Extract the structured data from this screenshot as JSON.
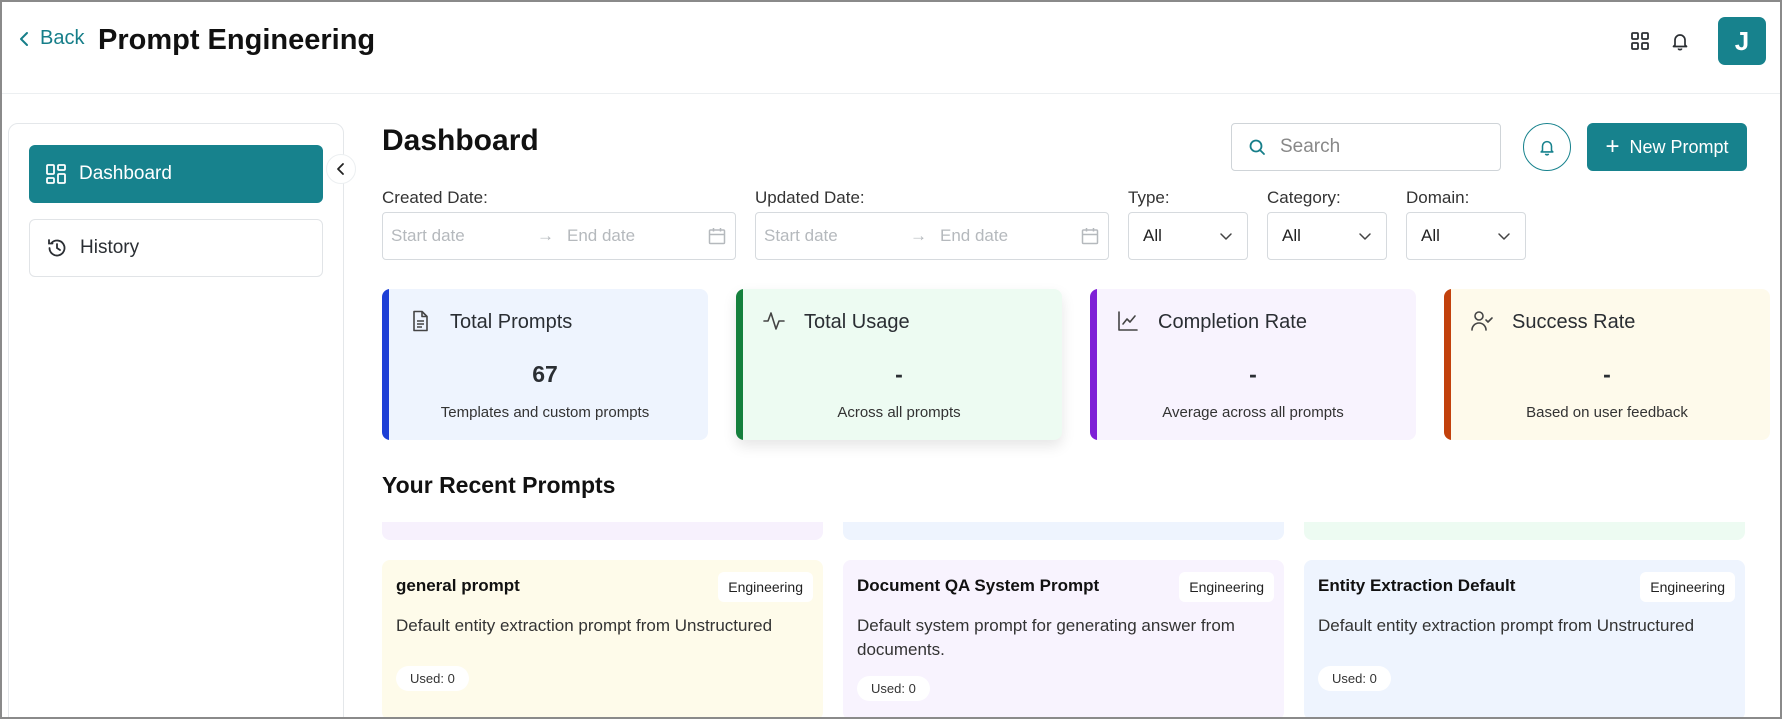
{
  "header": {
    "back_label": "Back",
    "title": "Prompt Engineering",
    "avatar_initial": "J"
  },
  "sidebar": {
    "items": [
      {
        "label": "Dashboard",
        "icon": "dashboard-icon",
        "active": true
      },
      {
        "label": "History",
        "icon": "history-icon",
        "active": false
      }
    ]
  },
  "main": {
    "title": "Dashboard",
    "search": {
      "placeholder": "Search"
    },
    "new_prompt_label": "New Prompt",
    "filters": {
      "created": {
        "label": "Created Date:",
        "start_placeholder": "Start date",
        "end_placeholder": "End date"
      },
      "updated": {
        "label": "Updated Date:",
        "start_placeholder": "Start date",
        "end_placeholder": "End date"
      },
      "type": {
        "label": "Type:",
        "value": "All"
      },
      "category": {
        "label": "Category:",
        "value": "All"
      },
      "domain": {
        "label": "Domain:",
        "value": "All"
      }
    },
    "stats": [
      {
        "title": "Total Prompts",
        "value": "67",
        "subtitle": "Templates and custom prompts",
        "icon": "document-icon",
        "accent": "#1d3fd6",
        "bg": "#eef4fe"
      },
      {
        "title": "Total Usage",
        "value": "-",
        "subtitle": "Across all prompts",
        "icon": "activity-icon",
        "accent": "#15803d",
        "bg": "#edfbf2"
      },
      {
        "title": "Completion Rate",
        "value": "-",
        "subtitle": "Average across all prompts",
        "icon": "chart-icon",
        "accent": "#7e1fd6",
        "bg": "#f8f3fe"
      },
      {
        "title": "Success Rate",
        "value": "-",
        "subtitle": "Based on user feedback",
        "icon": "user-check-icon",
        "accent": "#c2410c",
        "bg": "#fefaeb"
      }
    ],
    "recent_title": "Your Recent Prompts",
    "prompts": [
      {
        "title": "general prompt",
        "tag": "Engineering",
        "description": "Default entity extraction prompt from Unstructured",
        "used": "Used: 0",
        "bg": "#fefbea"
      },
      {
        "title": "Document QA System Prompt",
        "tag": "Engineering",
        "description": "Default system prompt for generating answer from documents.",
        "used": "Used: 0",
        "bg": "#f8f3fe"
      },
      {
        "title": "Entity Extraction Default",
        "tag": "Engineering",
        "description": "Default entity extraction prompt from Unstructured",
        "used": "Used: 0",
        "bg": "#eef4fe"
      }
    ]
  },
  "colors": {
    "brand": "#17828d",
    "strip_purple": "#f7f1fd",
    "strip_blue": "#eef4fe",
    "strip_green": "#edfbf2"
  }
}
